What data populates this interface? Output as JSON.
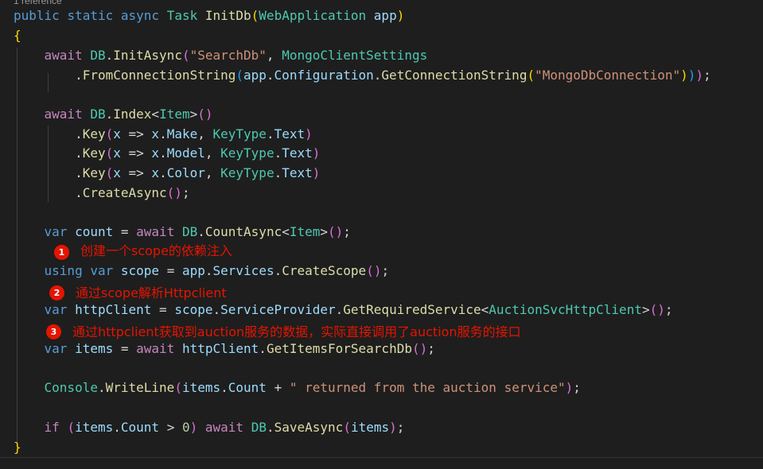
{
  "codelens": "1 reference",
  "lines": [
    [
      [
        "kw",
        "public"
      ],
      [
        "pl",
        " "
      ],
      [
        "kw",
        "static"
      ],
      [
        "pl",
        " "
      ],
      [
        "kw",
        "async"
      ],
      [
        "pl",
        " "
      ],
      [
        "ty",
        "Task"
      ],
      [
        "pl",
        " "
      ],
      [
        "fn",
        "InitDb"
      ],
      [
        "b1",
        "("
      ],
      [
        "ty",
        "WebApplication"
      ],
      [
        "pl",
        " "
      ],
      [
        "var",
        "app"
      ],
      [
        "b1",
        ")"
      ]
    ],
    [
      [
        "b1",
        "{"
      ]
    ],
    [
      [
        "pl",
        "    "
      ],
      [
        "ctl",
        "await"
      ],
      [
        "pl",
        " "
      ],
      [
        "ty",
        "DB"
      ],
      [
        "pl",
        "."
      ],
      [
        "fn",
        "InitAsync"
      ],
      [
        "b2",
        "("
      ],
      [
        "str",
        "\"SearchDb\""
      ],
      [
        "pl",
        ", "
      ],
      [
        "ty",
        "MongoClientSettings"
      ]
    ],
    [
      [
        "pl",
        "        ."
      ],
      [
        "fn",
        "FromConnectionString"
      ],
      [
        "b3",
        "("
      ],
      [
        "var",
        "app"
      ],
      [
        "pl",
        "."
      ],
      [
        "var",
        "Configuration"
      ],
      [
        "pl",
        "."
      ],
      [
        "fn",
        "GetConnectionString"
      ],
      [
        "b1",
        "("
      ],
      [
        "str",
        "\"MongoDbConnection\""
      ],
      [
        "b1",
        ")"
      ],
      [
        "b3",
        ")"
      ],
      [
        "b2",
        ")"
      ],
      [
        "pl",
        ";"
      ]
    ],
    [],
    [
      [
        "pl",
        "    "
      ],
      [
        "ctl",
        "await"
      ],
      [
        "pl",
        " "
      ],
      [
        "ty",
        "DB"
      ],
      [
        "pl",
        "."
      ],
      [
        "fn",
        "Index"
      ],
      [
        "pl",
        "<"
      ],
      [
        "ty",
        "Item"
      ],
      [
        "pl",
        ">"
      ],
      [
        "b2",
        "()"
      ]
    ],
    [
      [
        "pl",
        "        ."
      ],
      [
        "fn",
        "Key"
      ],
      [
        "b2",
        "("
      ],
      [
        "var",
        "x"
      ],
      [
        "pl",
        " => "
      ],
      [
        "var",
        "x"
      ],
      [
        "pl",
        "."
      ],
      [
        "var",
        "Make"
      ],
      [
        "pl",
        ", "
      ],
      [
        "ty",
        "KeyType"
      ],
      [
        "pl",
        "."
      ],
      [
        "var",
        "Text"
      ],
      [
        "b2",
        ")"
      ]
    ],
    [
      [
        "pl",
        "        ."
      ],
      [
        "fn",
        "Key"
      ],
      [
        "b2",
        "("
      ],
      [
        "var",
        "x"
      ],
      [
        "pl",
        " => "
      ],
      [
        "var",
        "x"
      ],
      [
        "pl",
        "."
      ],
      [
        "var",
        "Model"
      ],
      [
        "pl",
        ", "
      ],
      [
        "ty",
        "KeyType"
      ],
      [
        "pl",
        "."
      ],
      [
        "var",
        "Text"
      ],
      [
        "b2",
        ")"
      ]
    ],
    [
      [
        "pl",
        "        ."
      ],
      [
        "fn",
        "Key"
      ],
      [
        "b2",
        "("
      ],
      [
        "var",
        "x"
      ],
      [
        "pl",
        " => "
      ],
      [
        "var",
        "x"
      ],
      [
        "pl",
        "."
      ],
      [
        "var",
        "Color"
      ],
      [
        "pl",
        ", "
      ],
      [
        "ty",
        "KeyType"
      ],
      [
        "pl",
        "."
      ],
      [
        "var",
        "Text"
      ],
      [
        "b2",
        ")"
      ]
    ],
    [
      [
        "pl",
        "        ."
      ],
      [
        "fn",
        "CreateAsync"
      ],
      [
        "b2",
        "()"
      ],
      [
        "pl",
        ";"
      ]
    ],
    [],
    [
      [
        "pl",
        "    "
      ],
      [
        "kw",
        "var"
      ],
      [
        "pl",
        " "
      ],
      [
        "var",
        "count"
      ],
      [
        "pl",
        " = "
      ],
      [
        "ctl",
        "await"
      ],
      [
        "pl",
        " "
      ],
      [
        "ty",
        "DB"
      ],
      [
        "pl",
        "."
      ],
      [
        "fn",
        "CountAsync"
      ],
      [
        "pl",
        "<"
      ],
      [
        "ty",
        "Item"
      ],
      [
        "pl",
        ">"
      ],
      [
        "b2",
        "()"
      ],
      [
        "pl",
        ";"
      ]
    ],
    [],
    [
      [
        "pl",
        "    "
      ],
      [
        "kw",
        "using"
      ],
      [
        "pl",
        " "
      ],
      [
        "kw",
        "var"
      ],
      [
        "pl",
        " "
      ],
      [
        "var",
        "scope"
      ],
      [
        "pl",
        " = "
      ],
      [
        "var",
        "app"
      ],
      [
        "pl",
        "."
      ],
      [
        "var",
        "Services"
      ],
      [
        "pl",
        "."
      ],
      [
        "fn",
        "CreateScope"
      ],
      [
        "b2",
        "()"
      ],
      [
        "pl",
        ";"
      ]
    ],
    [],
    [
      [
        "pl",
        "    "
      ],
      [
        "kw",
        "var"
      ],
      [
        "pl",
        " "
      ],
      [
        "var",
        "httpClient"
      ],
      [
        "pl",
        " = "
      ],
      [
        "var",
        "scope"
      ],
      [
        "pl",
        "."
      ],
      [
        "var",
        "ServiceProvider"
      ],
      [
        "pl",
        "."
      ],
      [
        "fn",
        "GetRequiredService"
      ],
      [
        "pl",
        "<"
      ],
      [
        "ty",
        "AuctionSvcHttpClient"
      ],
      [
        "pl",
        ">"
      ],
      [
        "b2",
        "()"
      ],
      [
        "pl",
        ";"
      ]
    ],
    [],
    [
      [
        "pl",
        "    "
      ],
      [
        "kw",
        "var"
      ],
      [
        "pl",
        " "
      ],
      [
        "var",
        "items"
      ],
      [
        "pl",
        " = "
      ],
      [
        "ctl",
        "await"
      ],
      [
        "pl",
        " "
      ],
      [
        "var",
        "httpClient"
      ],
      [
        "pl",
        "."
      ],
      [
        "fn",
        "GetItemsForSearchDb"
      ],
      [
        "b2",
        "()"
      ],
      [
        "pl",
        ";"
      ]
    ],
    [],
    [
      [
        "pl",
        "    "
      ],
      [
        "ty",
        "Console"
      ],
      [
        "pl",
        "."
      ],
      [
        "fn",
        "WriteLine"
      ],
      [
        "b2",
        "("
      ],
      [
        "var",
        "items"
      ],
      [
        "pl",
        "."
      ],
      [
        "var",
        "Count"
      ],
      [
        "pl",
        " + "
      ],
      [
        "str",
        "\" returned from the auction service\""
      ],
      [
        "b2",
        ")"
      ],
      [
        "pl",
        ";"
      ]
    ],
    [],
    [
      [
        "pl",
        "    "
      ],
      [
        "ctl",
        "if"
      ],
      [
        "pl",
        " "
      ],
      [
        "b2",
        "("
      ],
      [
        "var",
        "items"
      ],
      [
        "pl",
        "."
      ],
      [
        "var",
        "Count"
      ],
      [
        "pl",
        " > "
      ],
      [
        "num",
        "0"
      ],
      [
        "b2",
        ")"
      ],
      [
        "pl",
        " "
      ],
      [
        "ctl",
        "await"
      ],
      [
        "pl",
        " "
      ],
      [
        "ty",
        "DB"
      ],
      [
        "pl",
        "."
      ],
      [
        "fn",
        "SaveAsync"
      ],
      [
        "b2",
        "("
      ],
      [
        "var",
        "items"
      ],
      [
        "b2",
        ")"
      ],
      [
        "pl",
        ";"
      ]
    ],
    [
      [
        "b1",
        "}"
      ]
    ]
  ],
  "annotations": [
    {
      "badge": "1",
      "text": "创建一个scope的依赖注入"
    },
    {
      "badge": "2",
      "text": "通过scope解析Httpclient"
    },
    {
      "badge": "3",
      "text": "通过httpclient获取到auction服务的数据，实际直接调用了auction服务的接口"
    }
  ],
  "colors": {
    "background": "#1e1e1e",
    "keyword": "#569cd6",
    "control": "#c586c0",
    "type": "#4ec9b0",
    "function": "#dcdcaa",
    "string": "#ce9178",
    "variable": "#9cdcfe",
    "annotation": "#e51400"
  }
}
